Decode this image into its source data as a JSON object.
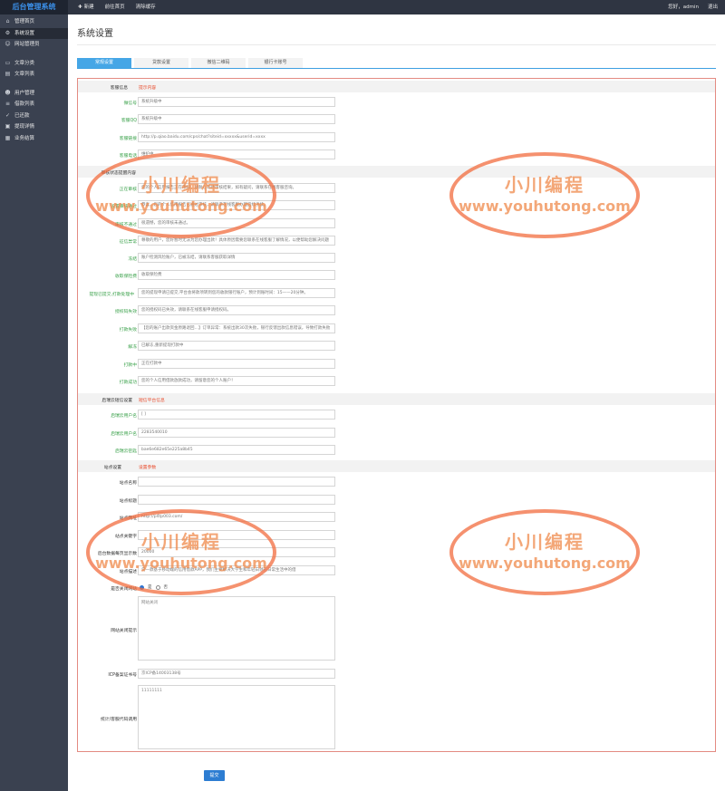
{
  "app": {
    "logo": "后台管理系统"
  },
  "topnav": [
    {
      "label": "新建"
    },
    {
      "label": "前往首页"
    },
    {
      "label": "清除缓存"
    }
  ],
  "topright": {
    "greeting": "您好，admin",
    "logout": "退出"
  },
  "sidebar": [
    {
      "label": "管理首页",
      "icon": "home-icon"
    },
    {
      "label": "系统设置",
      "icon": "gear-icon"
    },
    {
      "label": "网站管理员",
      "icon": "user-icon"
    },
    {
      "label": "文章分类",
      "icon": "folder-icon"
    },
    {
      "label": "文章列表",
      "icon": "doc-icon"
    },
    {
      "label": "用户管理",
      "icon": "users-icon"
    },
    {
      "label": "借款列表",
      "icon": "list-icon"
    },
    {
      "label": "已还款",
      "icon": "check-icon"
    },
    {
      "label": "提现详情",
      "icon": "wallet-icon"
    },
    {
      "label": "业务结算",
      "icon": "calc-icon"
    }
  ],
  "page": {
    "title": "系统设置"
  },
  "tabs": [
    "常规设置",
    "贷款设置",
    "微信二维码",
    "银行卡账号"
  ],
  "sections": {
    "kefu": {
      "label": "客服信息",
      "note": "提示内容"
    },
    "review": {
      "label": "审核状态提醒内容"
    },
    "cloud": {
      "label": "启瑞云短信设置",
      "note": "短信平台信息"
    },
    "site": {
      "label": "站点设置",
      "note": "设置参数"
    }
  },
  "fields": {
    "wechat": {
      "label": "微信号",
      "value": "系统升级中"
    },
    "qq": {
      "label": "客服QQ",
      "value": "系统升级中"
    },
    "link": {
      "label": "客服链接",
      "value": "http://p.qiao.baidu.com/cps/chat?siteid=xxxxx&userid=xxxx"
    },
    "phone": {
      "label": "客服电话",
      "value": "维护中"
    },
    "reviewing": {
      "label": "正在审核",
      "value": "您的个人信用报告正在审核，请耐心等待审核结果，如有疑问，请联系在线客服咨询。"
    },
    "review_pass": {
      "label": "设置审核通过",
      "value": "恭喜，您的个人信用报告已通过审核，请联系在线客服办理后续手续。"
    },
    "review_fail": {
      "label": "审核不通过",
      "value": "很遗憾，您的审核未通过。"
    },
    "credit_abnormal": {
      "label": "征信异常",
      "value": "尊敬的用户，您好暂时无法为您办理出款！具体原因需要您联系在线客服了解情况，以便帮助您解决问题"
    },
    "frozen": {
      "label": "冻结",
      "value": "账户检测风险账户，已被冻结，请联系客服获取详情"
    },
    "insurance": {
      "label": "收取保险费",
      "value": "收取保险费"
    },
    "withdraw_processing": {
      "label": "提现已提交,打款处理中",
      "value": "您的提现申请已提交,平台会将款项转到您的收款银行账户，预计到账时间：15——20分钟。"
    },
    "auth_fail": {
      "label": "授权码失效",
      "value": "您的授权码已失效，请联系在线客服申请授权码。"
    },
    "pay_fail": {
      "label": "打款失败",
      "value": "【您的账户出款资金原路退回…】订单异常：系统出款30次失败，银行反馈出款信息错误，导致打款失败"
    },
    "unfrozen": {
      "label": "解冻",
      "value": "已解冻,重新提现打款中"
    },
    "paying": {
      "label": "打款中",
      "value": "正在打款中"
    },
    "pay_success": {
      "label": "打款成功",
      "value": "您的个人信用借款放款成功，请留意您的个人账户！"
    },
    "cloud_user": {
      "label": "启瑞云用户名",
      "value": "[          ]"
    },
    "cloud_pass": {
      "label": "启瑞云用户名",
      "value": "2283540010"
    },
    "cloud_key": {
      "label": "启瑞云密匙",
      "value": "bae6e682e65e225a8b45"
    },
    "site_name": {
      "label": "站点名称",
      "value": ""
    },
    "site_title": {
      "label": "站点标题",
      "value": ""
    },
    "site_url": {
      "label": "站点网址",
      "value": "http://p4tp003.com/"
    },
    "site_keywords": {
      "label": "站点关键字",
      "value": ""
    },
    "backend_items": {
      "label": "后台数据每页显示数",
      "value": "20000"
    },
    "site_desc": {
      "label": "站点描述",
      "value": "贷一款基于移动端的信用借款APP，我们主要解决大学生和年轻白领在日常生活中的借"
    },
    "site_close": {
      "label": "是否关闭网站",
      "opt_yes": "是",
      "opt_no": "否"
    },
    "close_tip": {
      "label": "网站关闭提示",
      "value": "网站关闭"
    },
    "icp": {
      "label": "ICP备案证书号",
      "value": "京ICP备14003138号"
    },
    "stats": {
      "label": "统计/客服代码调用",
      "value": "11111111"
    }
  },
  "submit": {
    "label": "提交"
  },
  "watermark": {
    "line1": "小川编程",
    "line2": "www.youhutong.com"
  }
}
